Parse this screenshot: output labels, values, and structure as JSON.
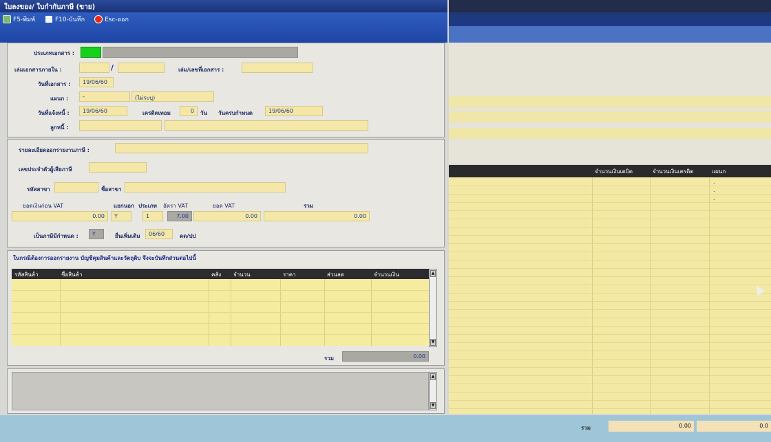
{
  "window": {
    "title": "ใบลงของ/ ใบกำกับภาษี (ขาย)"
  },
  "toolbar": {
    "print_label": "F5-พิมพ์",
    "save_label": "F10-บันทึก",
    "exit_label": "Esc-ออก"
  },
  "header_section": {
    "doc_type_label": "ประเภทเอกสาร :",
    "doc_type_value": "",
    "internal_doc_label": "เล่มเอกสารภายใน :",
    "internal_doc_a": "",
    "internal_doc_sep": "/",
    "internal_doc_b": "",
    "book_no_label": "เล่ม/เลขที่เอกสาร :",
    "book_no_value": "",
    "doc_date_label": "วันที่เอกสาร :",
    "doc_date_value": "19/06/60",
    "dept_label": "แผนก :",
    "dept_code": "-",
    "dept_name": "(ไม่ระบุ)",
    "due_date_label": "วันที่แจ้งหนี้ :",
    "due_date_value": "19/06/60",
    "credit_label": "เครดิตเทอม",
    "credit_value": "0",
    "credit_unit": "วัน",
    "deadline_label": "วันครบกำหนด",
    "deadline_value": "19/06/60",
    "customer_label": "ลูกหนี้ :",
    "customer_code": "",
    "customer_name": ""
  },
  "tax_section": {
    "detail_label": "รายละเอียดออกรายงานภาษี :",
    "detail_value": "",
    "taxid_label": "เลขประจำตัวผู้เสียภาษี",
    "taxid_value": "",
    "branch_code_label": "รหัสสาขา",
    "branch_code_value": "",
    "branch_name_label": "ชื่อสาขา",
    "branch_name_value": "",
    "amount_before_vat_label": "ยอดเงินก่อน VAT",
    "amount_before_vat": "0.00",
    "separate_label": "แยกนอก",
    "separate_value": "Y",
    "type_label": "ประเภท",
    "type_value": "1",
    "vat_rate_label": "อัตรา VAT",
    "vat_rate_value": "7.00",
    "vat_amount_label": "ยอด VAT",
    "vat_amount_value": "0.00",
    "total_label": "รวม",
    "total_value": "0.00",
    "is_tax_label": "เป็นภาษีมีกำหนด :",
    "is_tax_value": "Y",
    "file_label": "ยื่นเพิ่มเติม",
    "file_value": "06/60",
    "file_unit": "ดด/ปป"
  },
  "items_section": {
    "caption": "ในกรณีต้องการออกรายงาน บัญชีคุมสินค้าและวัตถุดิบ จึงจะบันทึกส่วนต่อไปนี้",
    "columns": [
      "รหัสสินค้า",
      "ชื่อสินค้า",
      "คลัง",
      "จำนวน",
      "ราคา",
      "ส่วนลด",
      "จำนวนเงิน"
    ],
    "total_label": "รวม",
    "total_value": "0.00"
  },
  "right_grid": {
    "columns": [
      "จำนวนเงินเดบิต",
      "จำนวนเงินเครดิต",
      "แผนก"
    ],
    "dash_marks": [
      ".",
      ".",
      "."
    ],
    "total_label": "รวม",
    "debit_total": "0.00",
    "credit_total": "0.0"
  }
}
